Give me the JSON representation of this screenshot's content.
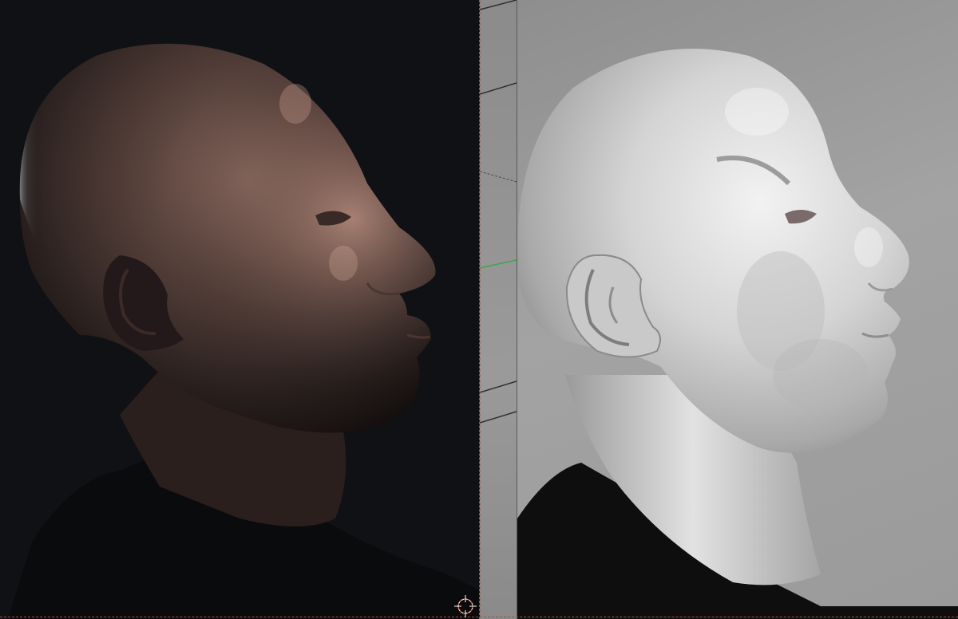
{
  "panels": {
    "render": {
      "label": ""
    },
    "viewport": {
      "label": ""
    },
    "sculpt": {
      "label": ""
    }
  },
  "colors": {
    "render_bg": "#0f1114",
    "viewport_bg": "#8f8f8f",
    "sculpt_bg": "#9c9c9c",
    "guide_line": "#b04a3a",
    "axis_green": "#3aa84a"
  },
  "icons": {
    "cursor_gizmo": "3d-cursor-icon"
  }
}
